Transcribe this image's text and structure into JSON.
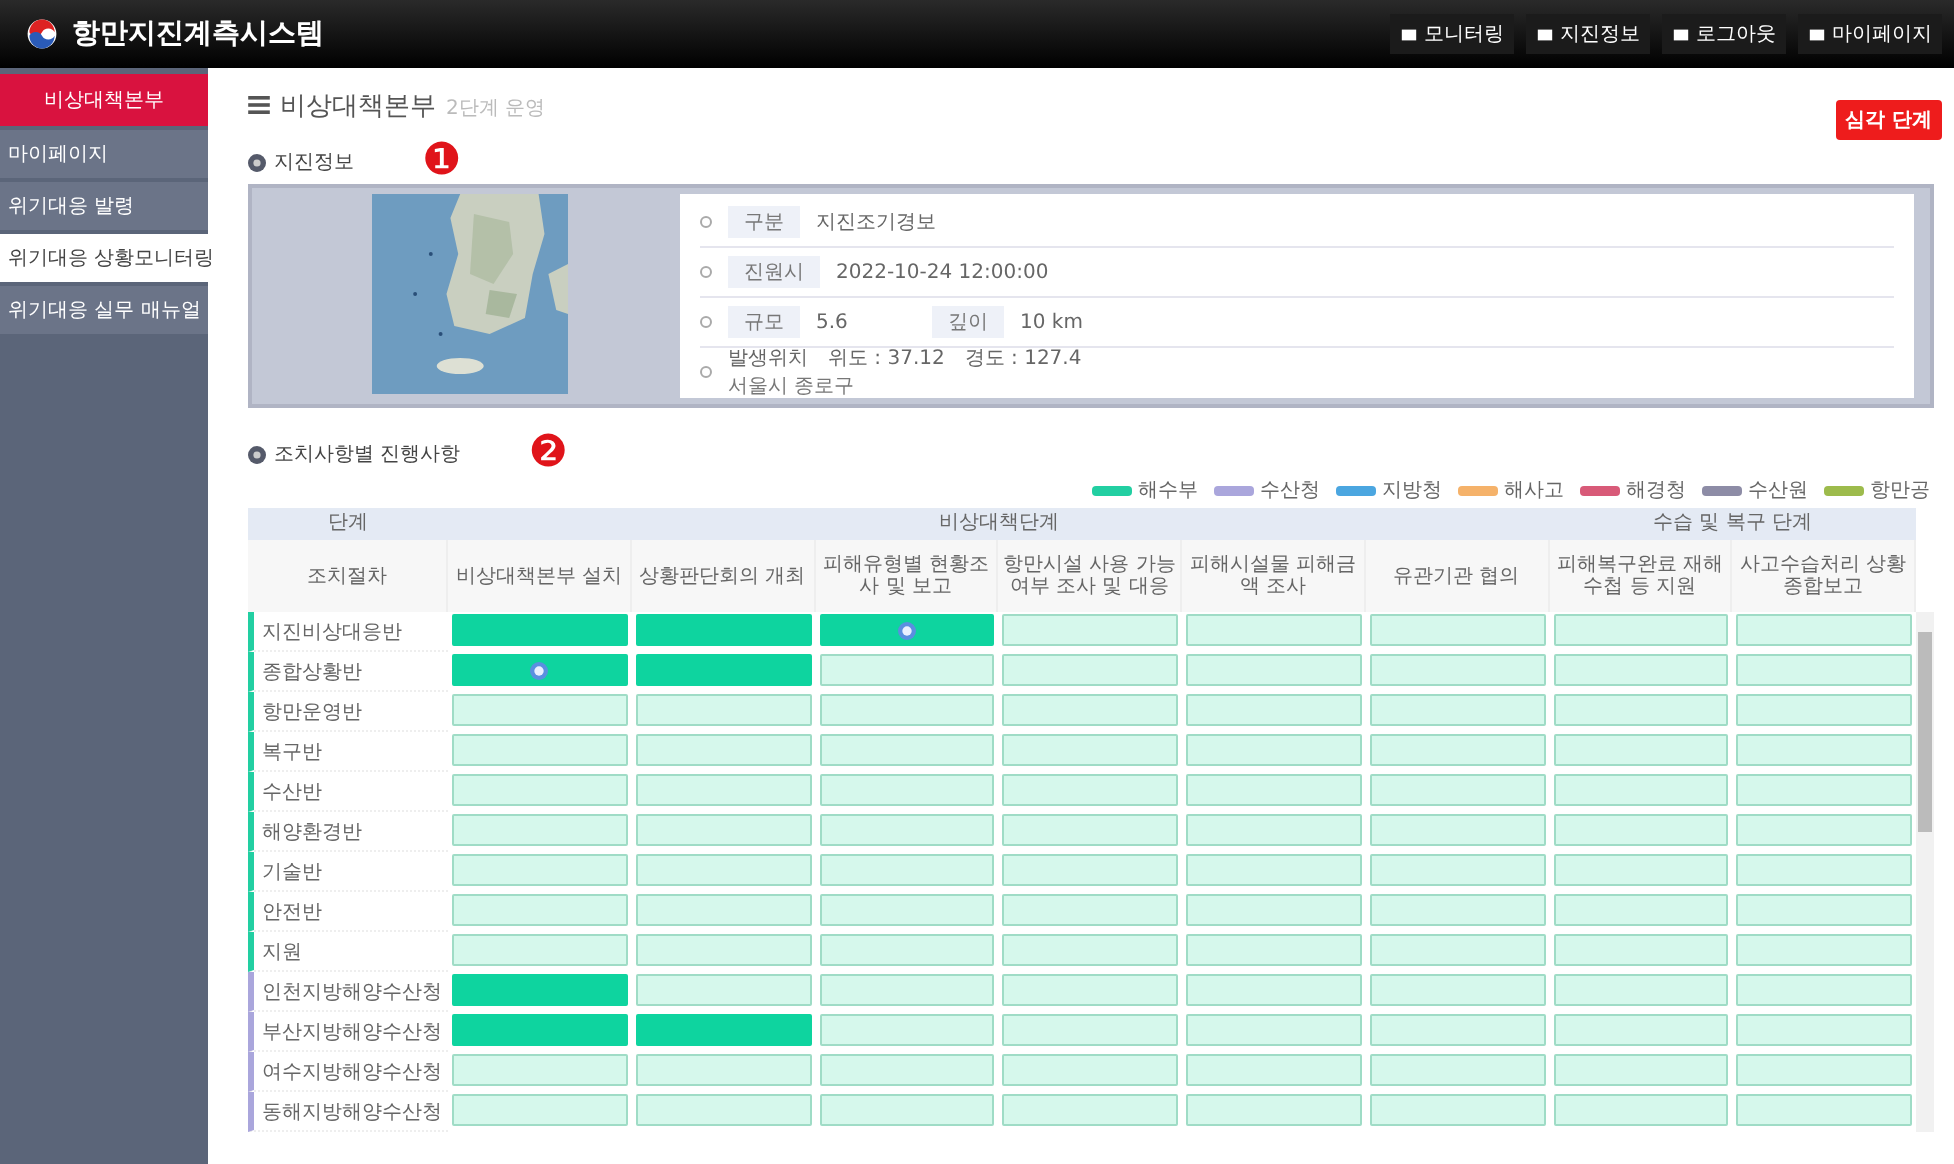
{
  "header": {
    "title": "항만지진계측시스템",
    "nav": [
      "모니터링",
      "지진정보",
      "로그아웃",
      "마이페이지"
    ]
  },
  "sidebar": {
    "title": "비상대책본부",
    "items": [
      {
        "label": "마이페이지",
        "selected": false
      },
      {
        "label": "위기대응 발령",
        "selected": false
      },
      {
        "label": "위기대응 상황모니터링",
        "selected": true
      },
      {
        "label": "위기대응 실무 매뉴얼",
        "selected": false
      }
    ]
  },
  "page": {
    "title": "비상대책본부",
    "subtitle": "2단계 운영",
    "level_badge": "심각 단계"
  },
  "quake": {
    "title": "지진정보",
    "marker": "❶",
    "fields": [
      {
        "kind": "single",
        "label": "구분",
        "value": "지진조기경보"
      },
      {
        "kind": "single",
        "label": "진원시",
        "value": "2022-10-24 12:00:00"
      },
      {
        "kind": "pair",
        "label": "규모",
        "value": "5.6",
        "label2": "깊이",
        "value2": "10 km"
      },
      {
        "kind": "location",
        "label": "발생위치",
        "value": "위도 : 37.12",
        "value2": "경도 : 127.4",
        "note": "서울시 종로구"
      }
    ]
  },
  "progress": {
    "title": "조치사항별 진행사항",
    "marker": "❷",
    "legend": [
      {
        "label": "해수부",
        "color": "#22cfa2"
      },
      {
        "label": "수산청",
        "color": "#aaa6dc"
      },
      {
        "label": "지방청",
        "color": "#4ba6e0"
      },
      {
        "label": "해사고",
        "color": "#f5b26a"
      },
      {
        "label": "해경청",
        "color": "#d85a78"
      },
      {
        "label": "수산원",
        "color": "#8d8ca6"
      },
      {
        "label": "항만공",
        "color": "#9dbb4c"
      }
    ],
    "groups": [
      {
        "label": "단계",
        "columns": [
          "조치절차"
        ]
      },
      {
        "label": "비상대책단계",
        "columns": [
          "비상대책본부 설치",
          "상황판단회의 개최",
          "피해유형별 현황조사 및 보고",
          "항만시설 사용 가능여부 조사 및 대응",
          "피해시설물 피해금액 조사",
          "유관기관 협의"
        ]
      },
      {
        "label": "수습 및 복구 단계",
        "columns": [
          "피해복구완료 재해수첩 등 지원",
          "사고수습처리 상황 종합보고"
        ]
      }
    ],
    "rows": [
      {
        "label": "지진비상대응반",
        "color": "#22cfa2",
        "cells": [
          {
            "done": true,
            "flag": false
          },
          {
            "done": true,
            "flag": false
          },
          {
            "done": true,
            "flag": true
          },
          {
            "done": false,
            "flag": false
          },
          {
            "done": false,
            "flag": false
          },
          {
            "done": false,
            "flag": false
          },
          {
            "done": false,
            "flag": false
          },
          {
            "done": false,
            "flag": false
          }
        ]
      },
      {
        "label": "종합상황반",
        "color": "#22cfa2",
        "cells": [
          {
            "done": true,
            "flag": true
          },
          {
            "done": true,
            "flag": false
          },
          {
            "done": false,
            "flag": false
          },
          {
            "done": false,
            "flag": false
          },
          {
            "done": false,
            "flag": false
          },
          {
            "done": false,
            "flag": false
          },
          {
            "done": false,
            "flag": false
          },
          {
            "done": false,
            "flag": false
          }
        ]
      },
      {
        "label": "항만운영반",
        "color": "#22cfa2",
        "cells": [
          {
            "done": false,
            "flag": false
          },
          {
            "done": false,
            "flag": false
          },
          {
            "done": false,
            "flag": false
          },
          {
            "done": false,
            "flag": false
          },
          {
            "done": false,
            "flag": false
          },
          {
            "done": false,
            "flag": false
          },
          {
            "done": false,
            "flag": false
          },
          {
            "done": false,
            "flag": false
          }
        ]
      },
      {
        "label": "복구반",
        "color": "#22cfa2",
        "cells": [
          {
            "done": false,
            "flag": false
          },
          {
            "done": false,
            "flag": false
          },
          {
            "done": false,
            "flag": false
          },
          {
            "done": false,
            "flag": false
          },
          {
            "done": false,
            "flag": false
          },
          {
            "done": false,
            "flag": false
          },
          {
            "done": false,
            "flag": false
          },
          {
            "done": false,
            "flag": false
          }
        ]
      },
      {
        "label": "수산반",
        "color": "#22cfa2",
        "cells": [
          {
            "done": false,
            "flag": false
          },
          {
            "done": false,
            "flag": false
          },
          {
            "done": false,
            "flag": false
          },
          {
            "done": false,
            "flag": false
          },
          {
            "done": false,
            "flag": false
          },
          {
            "done": false,
            "flag": false
          },
          {
            "done": false,
            "flag": false
          },
          {
            "done": false,
            "flag": false
          }
        ]
      },
      {
        "label": "해양환경반",
        "color": "#22cfa2",
        "cells": [
          {
            "done": false,
            "flag": false
          },
          {
            "done": false,
            "flag": false
          },
          {
            "done": false,
            "flag": false
          },
          {
            "done": false,
            "flag": false
          },
          {
            "done": false,
            "flag": false
          },
          {
            "done": false,
            "flag": false
          },
          {
            "done": false,
            "flag": false
          },
          {
            "done": false,
            "flag": false
          }
        ]
      },
      {
        "label": "기술반",
        "color": "#22cfa2",
        "cells": [
          {
            "done": false,
            "flag": false
          },
          {
            "done": false,
            "flag": false
          },
          {
            "done": false,
            "flag": false
          },
          {
            "done": false,
            "flag": false
          },
          {
            "done": false,
            "flag": false
          },
          {
            "done": false,
            "flag": false
          },
          {
            "done": false,
            "flag": false
          },
          {
            "done": false,
            "flag": false
          }
        ]
      },
      {
        "label": "안전반",
        "color": "#22cfa2",
        "cells": [
          {
            "done": false,
            "flag": false
          },
          {
            "done": false,
            "flag": false
          },
          {
            "done": false,
            "flag": false
          },
          {
            "done": false,
            "flag": false
          },
          {
            "done": false,
            "flag": false
          },
          {
            "done": false,
            "flag": false
          },
          {
            "done": false,
            "flag": false
          },
          {
            "done": false,
            "flag": false
          }
        ]
      },
      {
        "label": "지원",
        "color": "#22cfa2",
        "cells": [
          {
            "done": false,
            "flag": false
          },
          {
            "done": false,
            "flag": false
          },
          {
            "done": false,
            "flag": false
          },
          {
            "done": false,
            "flag": false
          },
          {
            "done": false,
            "flag": false
          },
          {
            "done": false,
            "flag": false
          },
          {
            "done": false,
            "flag": false
          },
          {
            "done": false,
            "flag": false
          }
        ]
      },
      {
        "label": "인천지방해양수산청",
        "color": "#aaa6dc",
        "cells": [
          {
            "done": true,
            "flag": false
          },
          {
            "done": false,
            "flag": false
          },
          {
            "done": false,
            "flag": false
          },
          {
            "done": false,
            "flag": false
          },
          {
            "done": false,
            "flag": false
          },
          {
            "done": false,
            "flag": false
          },
          {
            "done": false,
            "flag": false
          },
          {
            "done": false,
            "flag": false
          }
        ]
      },
      {
        "label": "부산지방해양수산청",
        "color": "#aaa6dc",
        "cells": [
          {
            "done": true,
            "flag": false
          },
          {
            "done": true,
            "flag": false
          },
          {
            "done": false,
            "flag": false
          },
          {
            "done": false,
            "flag": false
          },
          {
            "done": false,
            "flag": false
          },
          {
            "done": false,
            "flag": false
          },
          {
            "done": false,
            "flag": false
          },
          {
            "done": false,
            "flag": false
          }
        ]
      },
      {
        "label": "여수지방해양수산청",
        "color": "#aaa6dc",
        "cells": [
          {
            "done": false,
            "flag": false
          },
          {
            "done": false,
            "flag": false
          },
          {
            "done": false,
            "flag": false
          },
          {
            "done": false,
            "flag": false
          },
          {
            "done": false,
            "flag": false
          },
          {
            "done": false,
            "flag": false
          },
          {
            "done": false,
            "flag": false
          },
          {
            "done": false,
            "flag": false
          }
        ]
      },
      {
        "label": "동해지방해양수산청",
        "color": "#aaa6dc",
        "cells": [
          {
            "done": false,
            "flag": false
          },
          {
            "done": false,
            "flag": false
          },
          {
            "done": false,
            "flag": false
          },
          {
            "done": false,
            "flag": false
          },
          {
            "done": false,
            "flag": false
          },
          {
            "done": false,
            "flag": false
          },
          {
            "done": false,
            "flag": false
          },
          {
            "done": false,
            "flag": false
          }
        ]
      }
    ]
  }
}
